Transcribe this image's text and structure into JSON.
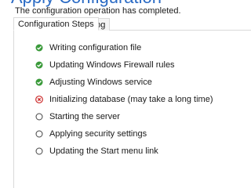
{
  "header": {
    "title": "Apply Configuration",
    "subtitle": "The configuration operation has completed."
  },
  "tabs": [
    {
      "label": "Configuration Steps",
      "active": true
    },
    {
      "label": "Log",
      "active": false
    }
  ],
  "steps": [
    {
      "label": "Writing configuration file",
      "status": "done",
      "icon": "check-circle-icon"
    },
    {
      "label": "Updating Windows Firewall rules",
      "status": "done",
      "icon": "check-circle-icon"
    },
    {
      "label": "Adjusting Windows service",
      "status": "done",
      "icon": "check-circle-icon"
    },
    {
      "label": "Initializing database (may take a long time)",
      "status": "failed",
      "icon": "error-circle-icon"
    },
    {
      "label": "Starting the server",
      "status": "pending",
      "icon": "empty-circle-icon"
    },
    {
      "label": "Applying security settings",
      "status": "pending",
      "icon": "empty-circle-icon"
    },
    {
      "label": "Updating the Start menu link",
      "status": "pending",
      "icon": "empty-circle-icon"
    }
  ],
  "colors": {
    "title": "#2b6bc4",
    "success": "#3a9a3a",
    "error": "#cc2a2a",
    "pending": "#444444"
  }
}
